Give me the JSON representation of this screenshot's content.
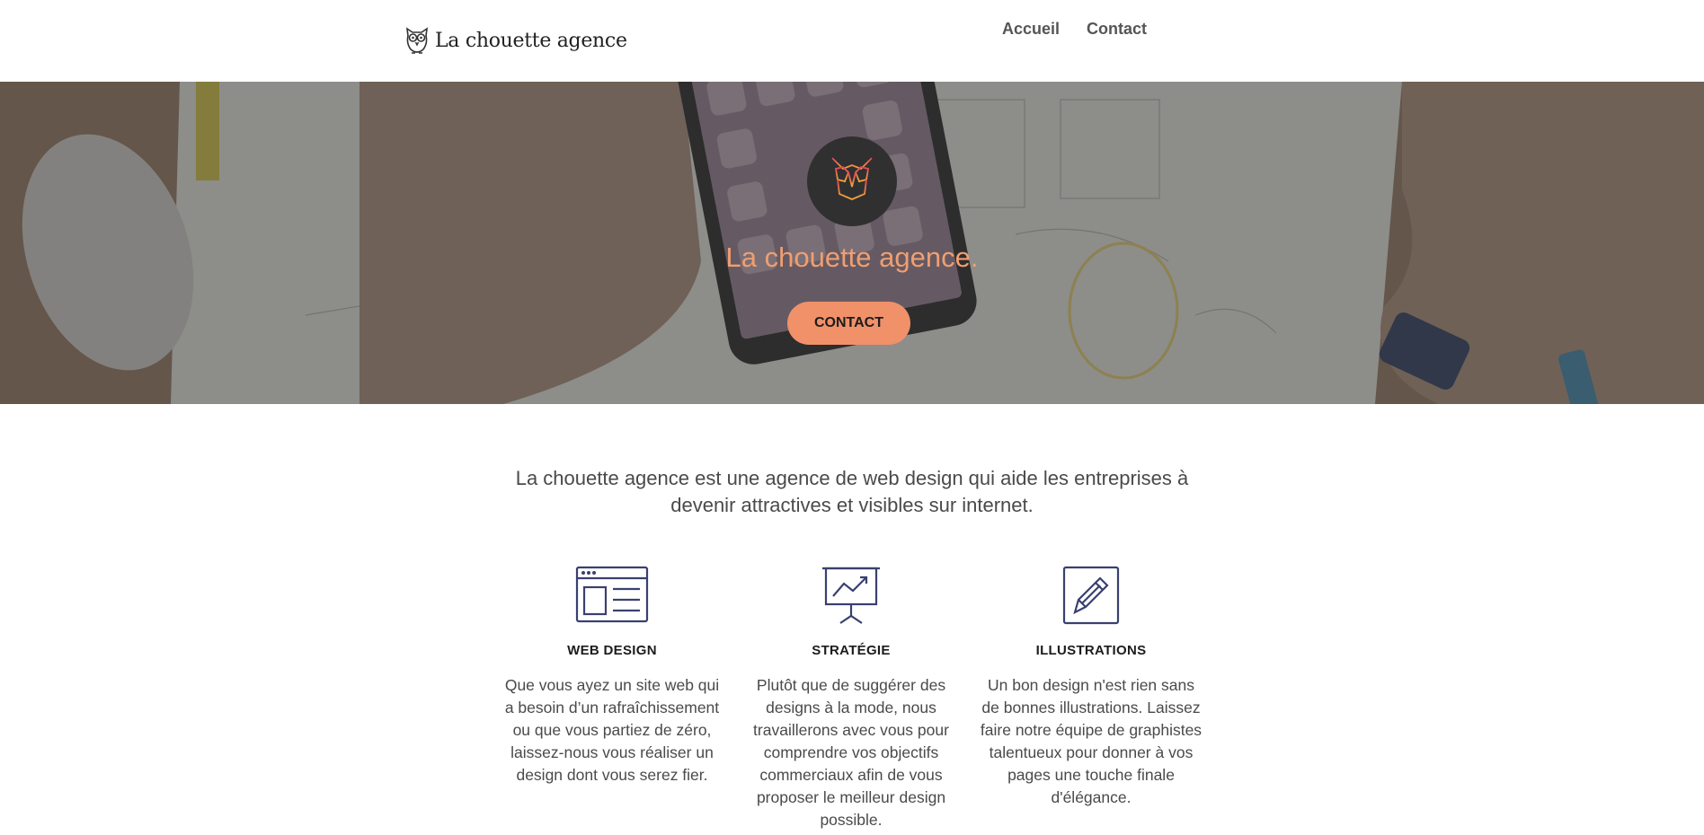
{
  "header": {
    "logo_text": "La chouette agence",
    "nav": [
      {
        "label": "Accueil"
      },
      {
        "label": "Contact"
      }
    ]
  },
  "hero": {
    "title": "La chouette agence.",
    "button_label": "CONTACT"
  },
  "intro": {
    "text": "La chouette agence est une agence de web design qui aide les entreprises à devenir attractives et visibles sur internet."
  },
  "features": [
    {
      "icon": "web-design-icon",
      "title": "WEB DESIGN",
      "text": "Que vous ayez un site web qui a besoin d’un rafraîchissement ou que vous partiez de zéro, laissez-nous vous réaliser un design dont vous serez fier."
    },
    {
      "icon": "strategy-chart-icon",
      "title": "STRATÉGIE",
      "text": "Plutôt que de suggérer des designs à la mode, nous travaillerons avec vous pour comprendre vos objectifs commerciaux afin de vous proposer le meilleur design possible."
    },
    {
      "icon": "pencil-icon",
      "title": "ILLUSTRATIONS",
      "text": "Un bon design n'est rien sans de bonnes illustrations. Laissez faire notre équipe de graphistes talentueux pour donner à vos pages une touche finale d'élégance."
    }
  ],
  "colors": {
    "accent": "#f0916a",
    "hero_title": "#f19e70",
    "icon_stroke": "#3a4070"
  }
}
